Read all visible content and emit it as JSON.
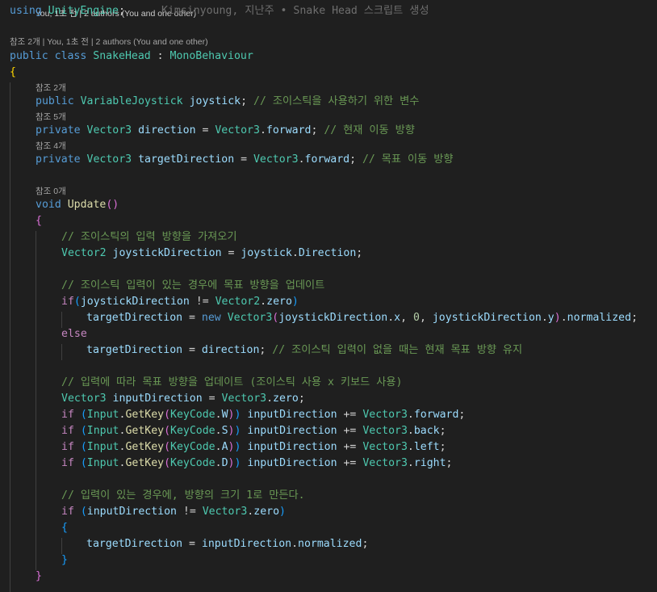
{
  "header": {
    "top_lens_partial": "You, 1초 전 | 2 authors (You and one other)",
    "using_keyword": "using",
    "using_namespace": "UnityEngine",
    "using_semicolon": ";",
    "git_blame": "Kimsinyoung, 지난주 • Snake Head 스크립트 생성"
  },
  "class_decl": {
    "codelens": "참조 2개 | You, 1초 전 | 2 authors (You and one other)",
    "modifier": "public",
    "keyword": "class",
    "name": "SnakeHead",
    "colon": " : ",
    "base": "MonoBehaviour"
  },
  "fields": {
    "joystick": {
      "codelens": "참조 2개",
      "modifier": "public",
      "type": "VariableJoystick",
      "name": "joystick",
      "comment": "// 조이스틱을 사용하기 위한 변수"
    },
    "direction": {
      "codelens": "참조 5개",
      "modifier": "private",
      "type": "Vector3",
      "name": "direction",
      "value_type": "Vector3",
      "value_member": "forward",
      "comment": "// 현재 이동 방향"
    },
    "target_direction": {
      "codelens": "참조 4개",
      "modifier": "private",
      "type": "Vector3",
      "name": "targetDirection",
      "value_type": "Vector3",
      "value_member": "forward",
      "comment": "// 목표 이동 방향"
    }
  },
  "update_method": {
    "codelens": "참조 0개",
    "return_type": "void",
    "name": "Update"
  },
  "body": {
    "comment_1": "// 조이스틱의 입력 방향을 가져오기",
    "js_dir_type": "Vector2",
    "js_dir_name": "joystickDirection",
    "js_obj": "joystick",
    "js_member": "Direction",
    "comment_2": "// 조이스틱 입력이 있는 경우에 목표 방향을 업데이트",
    "kw_if": "if",
    "kw_else": "else",
    "kw_new": "new",
    "target_name": "targetDirection",
    "vector2": "Vector2",
    "vector3": "Vector3",
    "zero": "zero",
    "x": "x",
    "y": "y",
    "zero_literal": "0",
    "normalized": "normalized",
    "direction_name": "direction",
    "comment_3": "// 조이스틱 입력이 없을 때는 현재 목표 방향 유지",
    "comment_4": "// 입력에 따라 목표 방향을 업데이트 (조이스틱 사용 x 키보드 사용)",
    "input_dir_name": "inputDirection",
    "input_class": "Input",
    "getkey": "GetKey",
    "keycode": "KeyCode",
    "keys": [
      "W",
      "S",
      "A",
      "D"
    ],
    "dirs": [
      "forward",
      "back",
      "left",
      "right"
    ],
    "comment_5": "// 입력이 있는 경우에, 방향의 크기 1로 만든다."
  }
}
